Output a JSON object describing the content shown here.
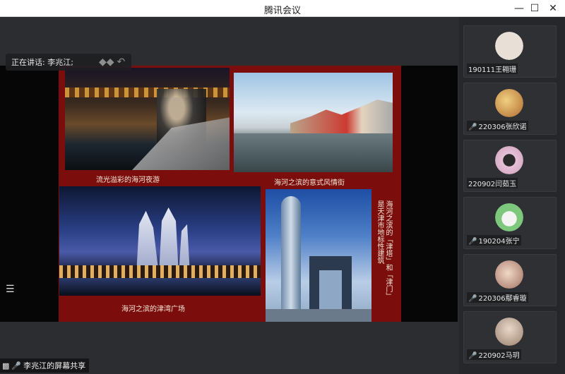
{
  "window": {
    "title": "腾讯会议"
  },
  "speaker": {
    "label": "正在讲话: 李兆江;"
  },
  "slide": {
    "captions": {
      "c1": "流光溢彩的海河夜游",
      "c2": "海河之滨的意式风情街",
      "c3": "海河之滨的津湾广场",
      "v1": "海河之滨的「津塔」和「津门」",
      "v2": "是天津市地标性建筑"
    }
  },
  "share": {
    "label": "李兆江的屏幕共享"
  },
  "participants": [
    {
      "name": "190111王翱珊",
      "muted": false,
      "color": "#e8e0d6"
    },
    {
      "name": "220306张欣诺",
      "muted": true,
      "color": "#c8a060"
    },
    {
      "name": "220902闫茹玉",
      "muted": false,
      "color": "#d8b8c8"
    },
    {
      "name": "190204张宁",
      "muted": true,
      "color": "#7ec87e"
    },
    {
      "name": "220306鄢睿璇",
      "muted": true,
      "color": "#c89a80"
    },
    {
      "name": "220902马玥",
      "muted": true,
      "color": "#d0c4b8"
    }
  ],
  "icons": {
    "minimize": "minimize-icon",
    "maximize": "maximize-icon",
    "close": "close-icon",
    "list": "list-icon",
    "mic": "mic-icon",
    "mute": "mic-muted-icon"
  }
}
